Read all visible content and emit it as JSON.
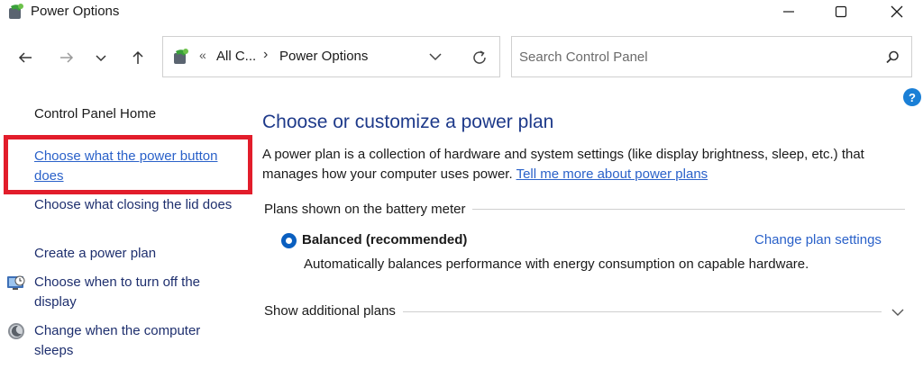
{
  "window": {
    "title": "Power Options"
  },
  "address": {
    "crumb_prefix": "«",
    "crumb_1": "All C...",
    "separator": "›",
    "crumb_2": "Power Options"
  },
  "search": {
    "placeholder": "Search Control Panel"
  },
  "help": {
    "label": "?"
  },
  "sidebar": {
    "home": "Control Panel Home",
    "items": [
      {
        "label": "Choose what the power button does"
      },
      {
        "label": "Choose what closing the lid does"
      },
      {
        "label": "Create a power plan"
      },
      {
        "label": "Choose when to turn off the display"
      },
      {
        "label": "Change when the computer sleeps"
      }
    ]
  },
  "main": {
    "title": "Choose or customize a power plan",
    "description": "A power plan is a collection of hardware and system settings (like display brightness, sleep, etc.) that manages how your computer uses power.",
    "learn_more": "Tell me more about power plans",
    "plans_section": "Plans shown on the battery meter",
    "plan": {
      "name": "Balanced (recommended)",
      "change_link": "Change plan settings",
      "description": "Automatically balances performance with energy consumption on capable hardware."
    },
    "additional_plans": "Show additional plans"
  },
  "colors": {
    "link": "#2a61c9",
    "heading": "#1e3a8a",
    "highlight_box": "#e21d2b",
    "radio": "#0a5fc0"
  }
}
